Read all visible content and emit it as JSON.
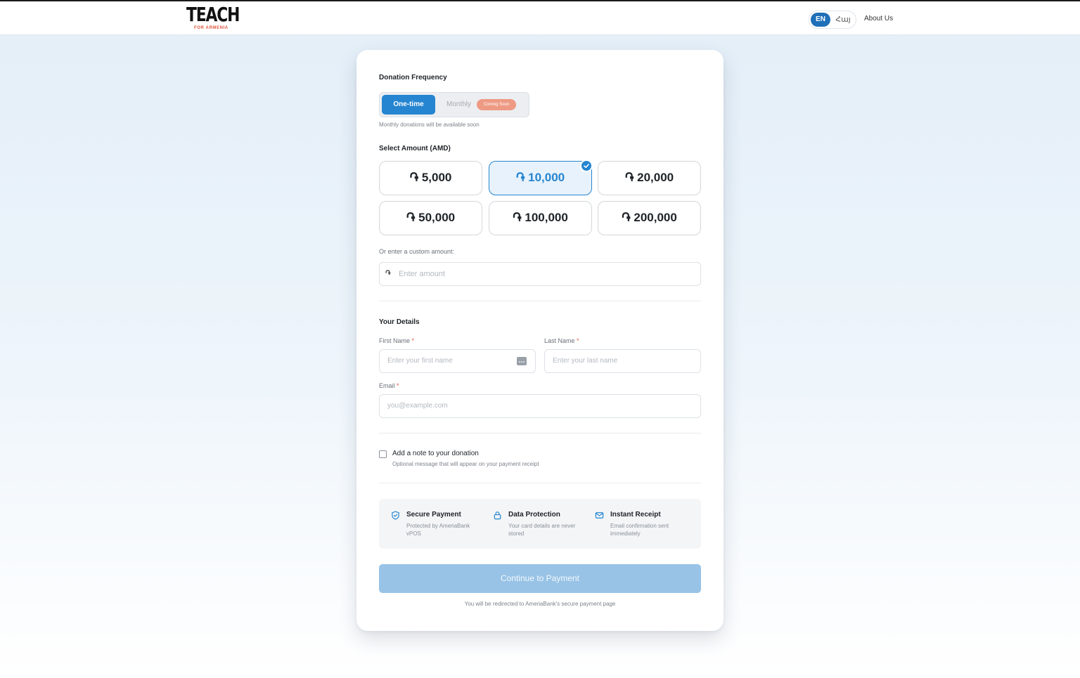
{
  "header": {
    "logo_main": "TEACH",
    "logo_sub": "FOR ARMENIA",
    "lang_en": "EN",
    "lang_hy": "Հայ",
    "about": "About Us"
  },
  "frequency": {
    "label": "Donation Frequency",
    "one_time": "One-time",
    "monthly": "Monthly",
    "coming_soon": "Coming Soon",
    "hint": "Monthly donations will be available soon"
  },
  "amount": {
    "label": "Select Amount (AMD)",
    "options": [
      "֏ 5,000",
      "֏ 10,000",
      "֏ 20,000",
      "֏ 50,000",
      "֏ 100,000",
      "֏ 200,000"
    ],
    "selected_index": 1,
    "custom_label": "Or enter a custom amount:",
    "currency_symbol": "֏",
    "custom_placeholder": "Enter amount"
  },
  "details": {
    "label": "Your Details",
    "first_name_label": "First Name",
    "first_name_placeholder": "Enter your first name",
    "last_name_label": "Last Name",
    "last_name_placeholder": "Enter your last name",
    "email_label": "Email",
    "email_placeholder": "you@example.com",
    "required_mark": "*"
  },
  "note": {
    "label": "Add a note to your donation",
    "hint": "Optional message that will appear on your payment receipt"
  },
  "security": [
    {
      "icon": "shield-icon",
      "title": "Secure Payment",
      "desc": "Protected by AmeriaBank vPOS"
    },
    {
      "icon": "lock-icon",
      "title": "Data Protection",
      "desc": "Your card details are never stored"
    },
    {
      "icon": "mail-icon",
      "title": "Instant Receipt",
      "desc": "Email confirmation sent immediately"
    }
  ],
  "submit": {
    "label": "Continue to Payment",
    "redirect_note": "You will be redirected to AmeriaBank's secure payment page"
  },
  "colors": {
    "accent": "#2585d0",
    "brand_red": "#e2553d",
    "button_disabled": "#98c3e6"
  }
}
